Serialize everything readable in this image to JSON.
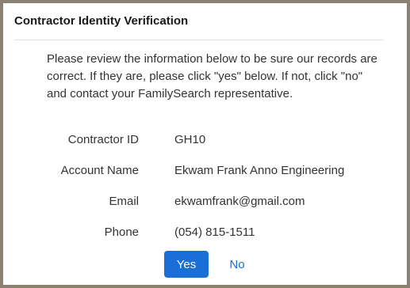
{
  "dialog": {
    "title": "Contractor Identity Verification",
    "message": "Please review the information below to be sure our records are correct. If they are, please click \"yes\" below. If not, click \"no\" and contact your FamilySearch representative."
  },
  "fields": {
    "contractor_id": {
      "label": "Contractor ID",
      "value": "GH10"
    },
    "account_name": {
      "label": "Account Name",
      "value": "Ekwam Frank Anno Engineering"
    },
    "email": {
      "label": "Email",
      "value": "ekwamfrank@gmail.com"
    },
    "phone": {
      "label": "Phone",
      "value": "(054) 815-1511"
    }
  },
  "actions": {
    "yes_label": "Yes",
    "no_label": "No"
  },
  "colors": {
    "accent": "#1a6fd6",
    "backdrop": "#8a8173",
    "text": "#333333"
  }
}
